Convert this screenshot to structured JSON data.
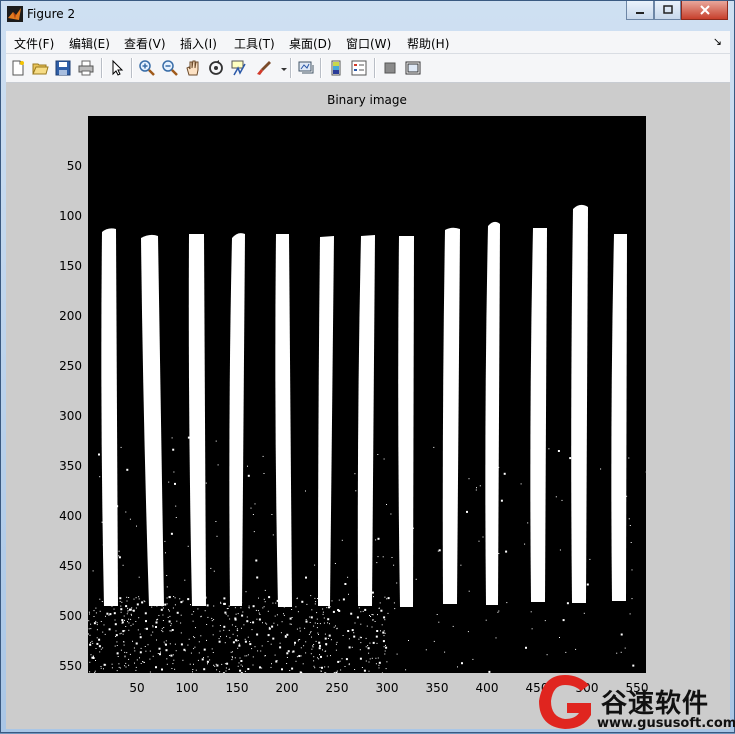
{
  "window": {
    "title": "Figure 2"
  },
  "menu": [
    "文件(F)",
    "编辑(E)",
    "查看(V)",
    "插入(I)",
    "工具(T)",
    "桌面(D)",
    "窗口(W)",
    "帮助(H)"
  ],
  "toolbar": {
    "icons": [
      "new-figure-icon",
      "open-file-icon",
      "save-icon",
      "print-icon",
      "pointer-icon",
      "zoom-in-icon",
      "zoom-out-icon",
      "pan-hand-icon",
      "rotate-3d-icon",
      "data-cursor-icon",
      "brush-icon",
      "link-plot-icon",
      "colorbar-icon",
      "legend-icon",
      "hide-plot-tools-icon",
      "show-plot-tools-icon"
    ]
  },
  "plot": {
    "title": "Binary image",
    "yticks": [
      "50",
      "100",
      "150",
      "200",
      "250",
      "300",
      "350",
      "400",
      "450",
      "500",
      "550"
    ],
    "xticks": [
      "50",
      "100",
      "150",
      "200",
      "250",
      "300",
      "350",
      "400",
      "450",
      "500",
      "550"
    ]
  },
  "watermark": {
    "brand": "谷速软件",
    "url": "www.gususoft.com"
  },
  "colors": {
    "axes_bg": "#000000",
    "stripe": "#ffffff",
    "figure_bg": "#cccccc"
  }
}
